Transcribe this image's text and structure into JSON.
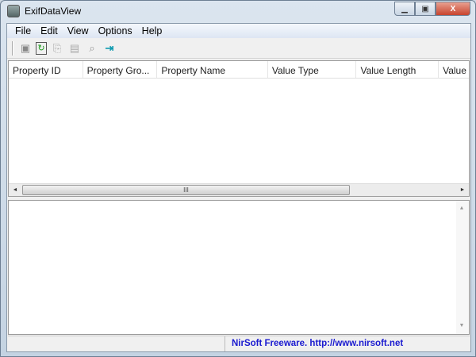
{
  "window": {
    "title": "ExifDataView",
    "minimize": "▭",
    "maximize": "◻",
    "close": "X"
  },
  "menu": [
    "File",
    "Edit",
    "View",
    "Options",
    "Help"
  ],
  "toolbar": [
    {
      "icon": "save-icon",
      "g": "💾"
    },
    {
      "icon": "refresh-icon",
      "g": "♻"
    },
    {
      "icon": "copy-icon",
      "g": "⎘"
    },
    {
      "icon": "properties-icon",
      "g": "▤"
    },
    {
      "icon": "find-icon",
      "g": "🔍"
    },
    {
      "icon": "exit-icon",
      "g": "⇥"
    }
  ],
  "columns": [
    "Property ID",
    "Property Gro...",
    "Property Name",
    "Value Type",
    "Value Length",
    "Value"
  ],
  "scroll": {
    "left": "◄",
    "right": "►",
    "up": "▲",
    "down": "▼",
    "grip": "III"
  },
  "status": {
    "link": "NirSoft Freeware.  http://www.nirsoft.net"
  }
}
